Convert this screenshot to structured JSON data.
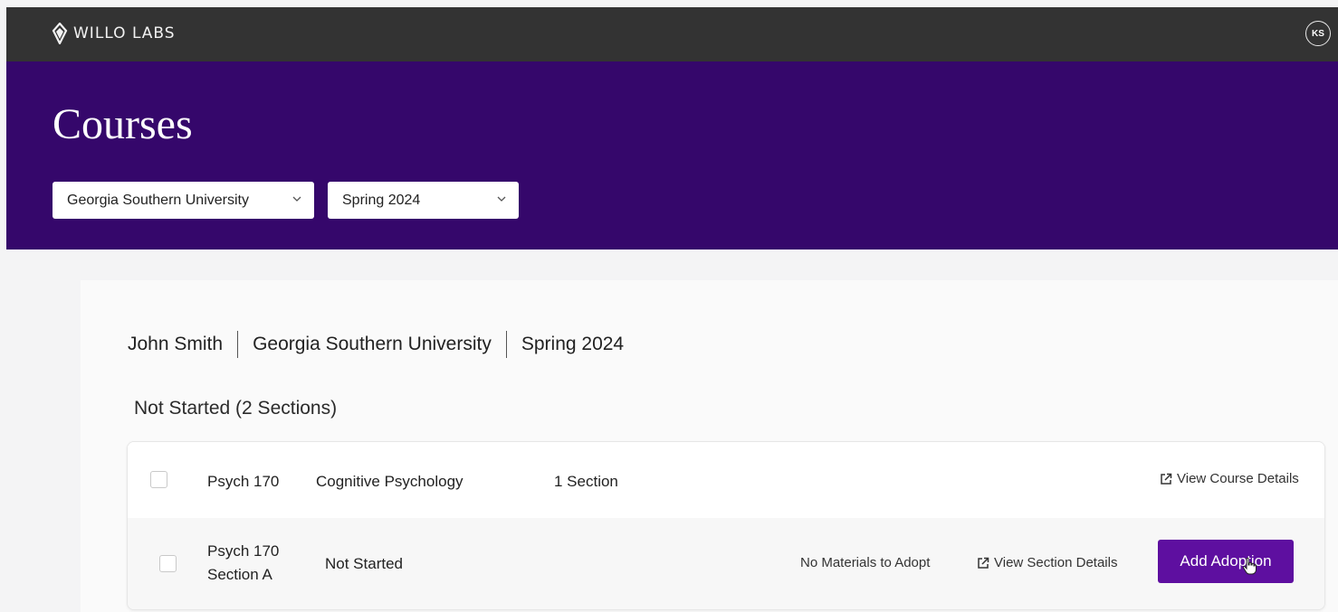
{
  "app": {
    "brand": "WILLO LABS",
    "user_initials": "KS"
  },
  "hero": {
    "title": "Courses",
    "school_select": {
      "value": "Georgia Southern University"
    },
    "term_select": {
      "value": "Spring 2024"
    }
  },
  "context": {
    "instructor": "John Smith",
    "school": "Georgia Southern University",
    "term": "Spring 2024"
  },
  "group": {
    "title": "Not Started (2 Sections)",
    "course": {
      "code": "Psych 170",
      "name": "Cognitive Psychology",
      "sections": "1 Section",
      "view_details": "View Course Details"
    },
    "section": {
      "code": "Psych 170",
      "section": "Section A",
      "status": "Not Started",
      "materials": "No Materials to Adopt",
      "view_details": "View Section Details",
      "action": "Add Adoption"
    }
  },
  "colors": {
    "topbar": "#333333",
    "hero": "#35076b",
    "button": "#5e0fa0"
  },
  "icons": {
    "logo": "willo-diamond-icon",
    "link": "external-link-icon",
    "select": "chevron-down-icon"
  }
}
